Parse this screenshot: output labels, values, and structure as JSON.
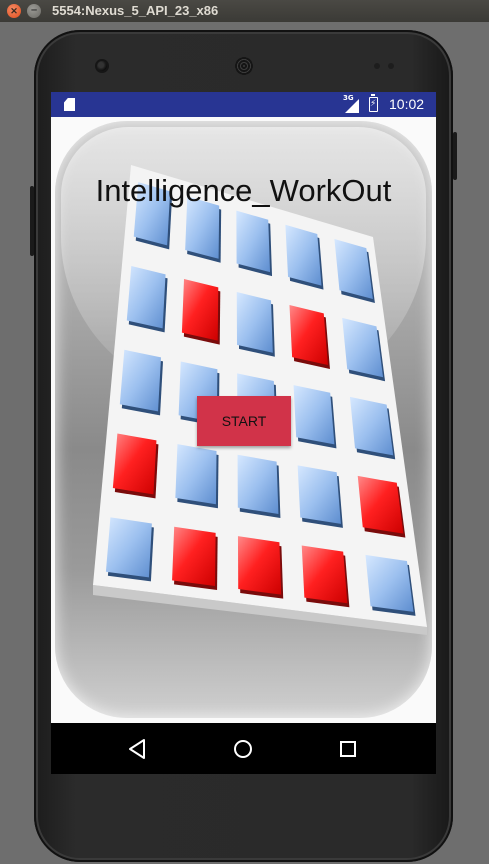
{
  "window": {
    "title": "5554:Nexus_5_API_23_x86"
  },
  "status_bar": {
    "time": "10:02",
    "network_label": "3G",
    "icons": [
      "sd-card-icon",
      "signal-icon",
      "battery-charging-icon"
    ]
  },
  "app": {
    "title": "Intelligence_WorkOut",
    "start_label": "START",
    "grid": {
      "rows": 5,
      "cols": 5,
      "cells": [
        [
          "blue",
          "blue",
          "blue",
          "blue",
          "blue"
        ],
        [
          "blue",
          "red",
          "blue",
          "red",
          "blue"
        ],
        [
          "blue",
          "blue",
          "blue",
          "blue",
          "blue"
        ],
        [
          "red",
          "blue",
          "blue",
          "blue",
          "red"
        ],
        [
          "blue",
          "red",
          "red",
          "red",
          "blue"
        ]
      ]
    }
  },
  "nav_bar": {
    "buttons": [
      "back-icon",
      "home-icon",
      "recents-icon"
    ]
  },
  "colors": {
    "status_bar": "#283593",
    "start_button": "#d13349",
    "tile_blue": "#8fb4e8",
    "tile_red": "#ff1a1a"
  }
}
